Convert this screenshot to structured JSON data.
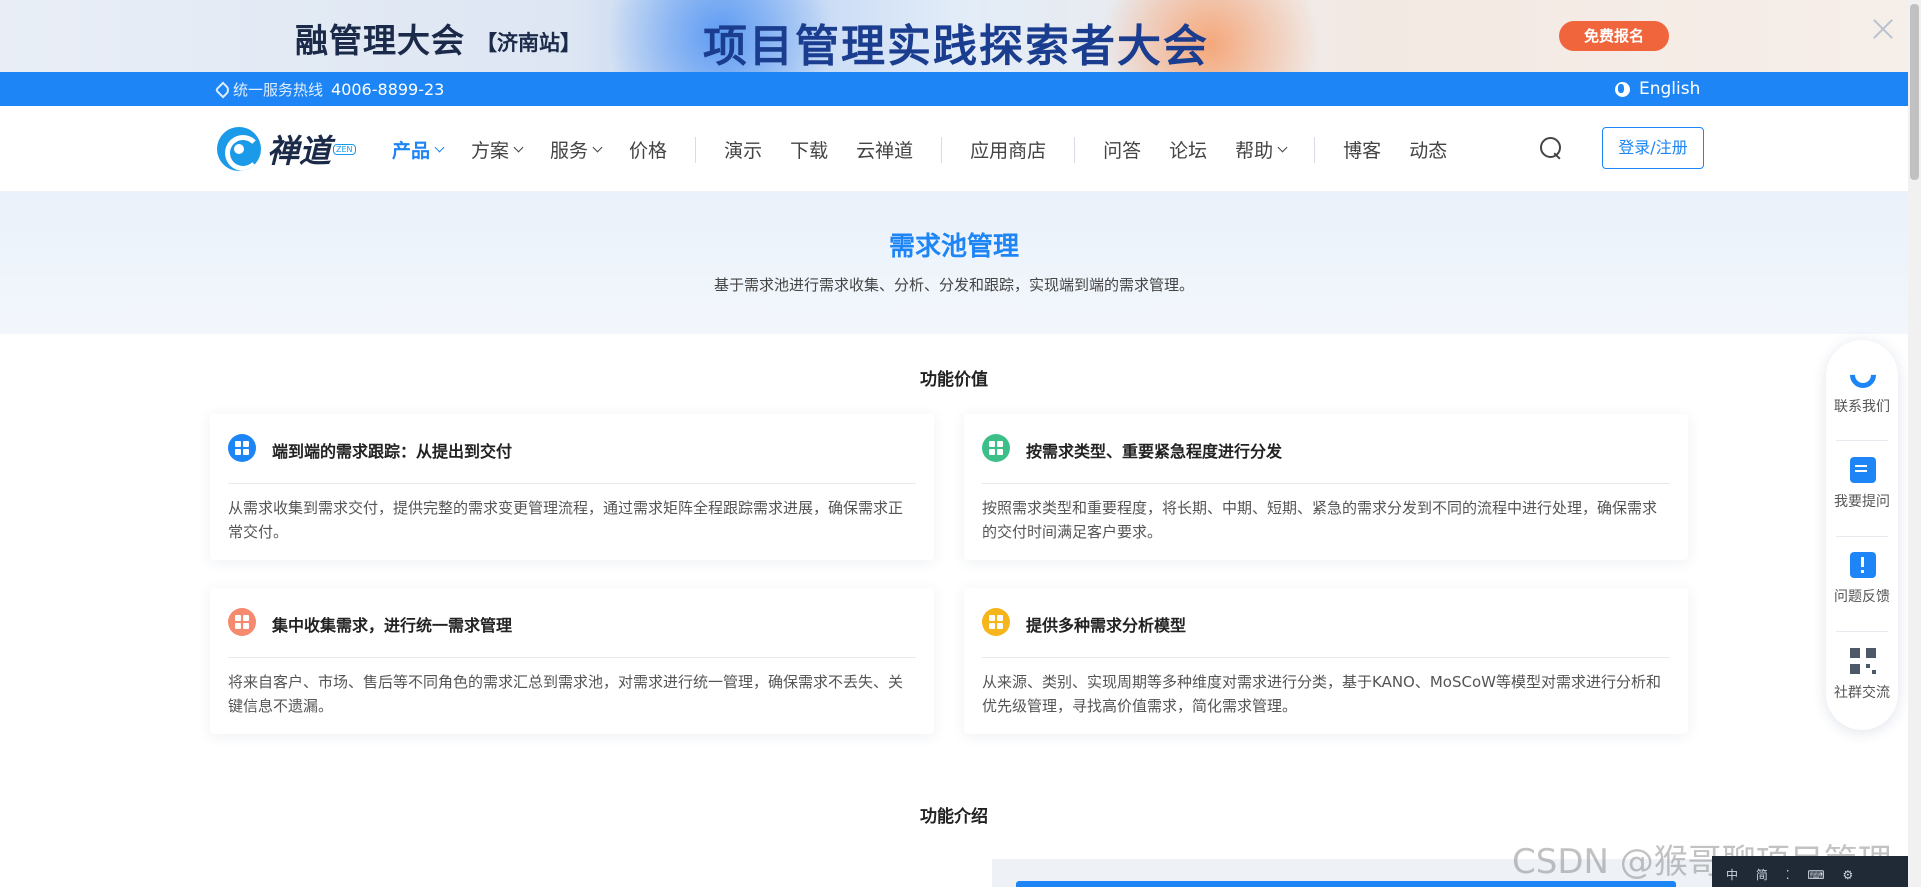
{
  "banner": {
    "left_text": "融管理大会",
    "station": "【济南站】",
    "title": "项目管理实践探索者大会",
    "cta": "免费报名"
  },
  "topbar": {
    "hotline_label": "统一服务热线",
    "hotline_number": "4006-8899-23",
    "language": "English"
  },
  "nav": {
    "logo_text": "禅道",
    "logo_tag": "ZEN",
    "menu": {
      "product": "产品",
      "solution": "方案",
      "service": "服务",
      "price": "价格",
      "demo": "演示",
      "download": "下载",
      "cloud": "云禅道",
      "app_store": "应用商店",
      "qa": "问答",
      "forum": "论坛",
      "help": "帮助",
      "blog": "博客",
      "news": "动态"
    },
    "login": "登录/注册"
  },
  "hero": {
    "title": "需求池管理",
    "subtitle": "基于需求池进行需求收集、分析、分发和跟踪，实现端到端的需求管理。"
  },
  "sections": {
    "value_title": "功能价值",
    "intro_title": "功能介绍"
  },
  "cards": [
    {
      "title": "端到端的需求跟踪：从提出到交付",
      "desc": "从需求收集到需求交付，提供完整的需求变更管理流程，通过需求矩阵全程跟踪需求进展，确保需求正常交付。",
      "color": "#1d85f5"
    },
    {
      "title": "按需求类型、重要紧急程度进行分发",
      "desc": "按照需求类型和重要程度，将长期、中期、短期、紧急的需求分发到不同的流程中进行处理，确保需求的交付时间满足客户要求。",
      "color": "#3dbf8a"
    },
    {
      "title": "集中收集需求，进行统一需求管理",
      "desc": "将来自客户、市场、售后等不同角色的需求汇总到需求池，对需求进行统一管理，确保需求不丢失、关键信息不遗漏。",
      "color": "#f58a6e"
    },
    {
      "title": "提供多种需求分析模型",
      "desc": "从来源、类别、实现周期等多种维度对需求进行分类，基于KANO、MoSCoW等模型对需求进行分析和优先级管理，寻找高价值需求，简化需求管理。",
      "color": "#f7b51c"
    }
  ],
  "side": {
    "contact": "联系我们",
    "ask": "我要提问",
    "feedback": "问题反馈",
    "community": "社群交流"
  },
  "watermark": "CSDN @猴哥聊项目管理",
  "ime": [
    "中",
    "简",
    "⁚",
    "⌨",
    "⚙"
  ]
}
